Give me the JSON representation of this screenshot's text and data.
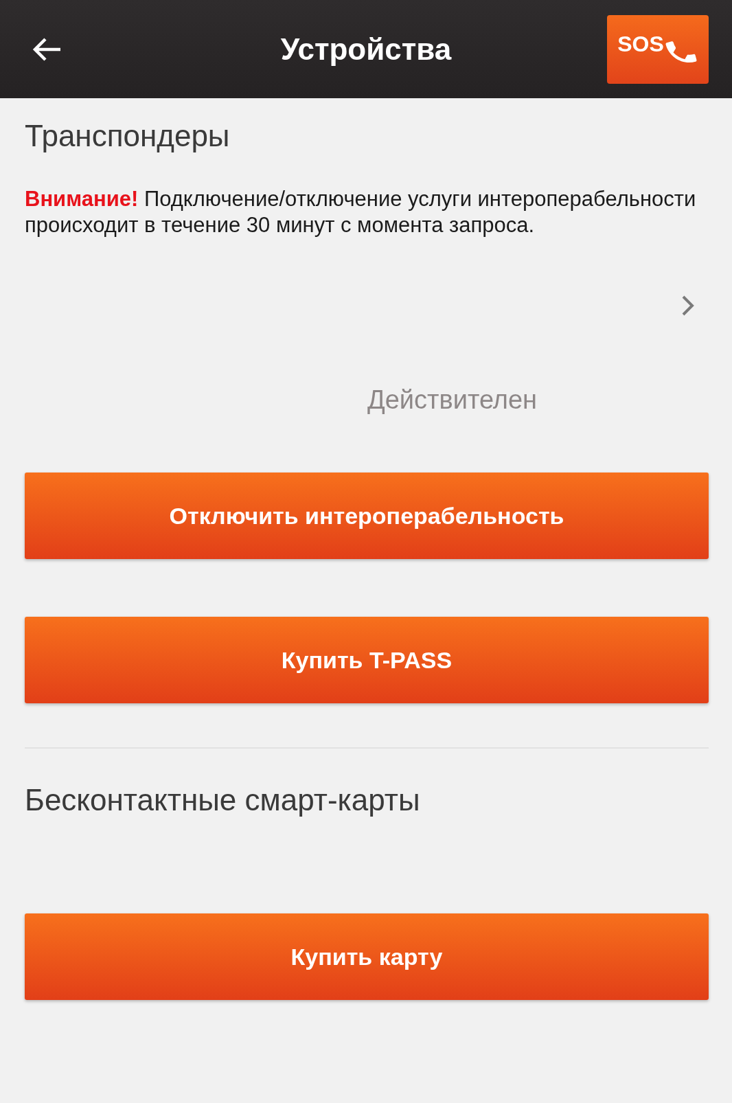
{
  "header": {
    "title": "Устройства",
    "sos_label": "SOS"
  },
  "transponders": {
    "heading": "Транспондеры",
    "warning_label": "Внимание!",
    "warning_text": "Подключение/отключение услуги интероперабельности происходит в течение 30 минут с момента запроса.",
    "status": "Действителен",
    "buttons": [
      "Отключить интероперабельность",
      "Купить T-PASS"
    ]
  },
  "smart_cards": {
    "heading": "Бесконтактные смарт-карты",
    "buttons": [
      "Купить карту"
    ]
  }
}
